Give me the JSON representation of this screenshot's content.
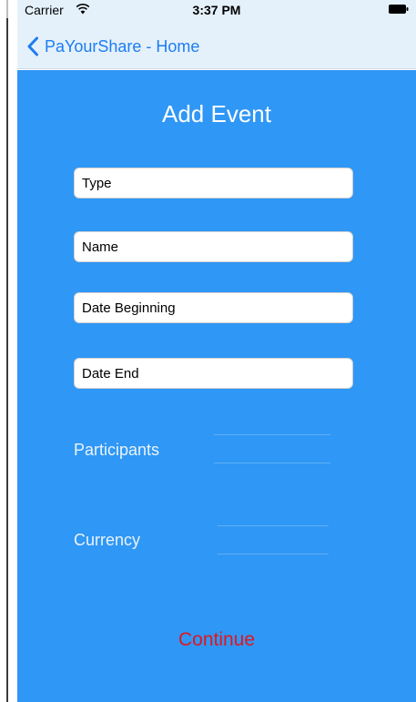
{
  "status_bar": {
    "carrier": "Carrier",
    "time": "3:37 PM",
    "wifi_icon": "wifi-icon",
    "battery_icon": "battery-icon"
  },
  "nav_bar": {
    "back_label": "PaYourShare - Home",
    "back_icon": "chevron-left-icon"
  },
  "form": {
    "title": "Add Event",
    "fields": {
      "type_placeholder": "Type",
      "name_placeholder": "Name",
      "date_begin_placeholder": "Date Beginning",
      "date_end_placeholder": "Date End"
    },
    "participants_label": "Participants",
    "currency_label": "Currency",
    "continue_label": "Continue"
  },
  "colors": {
    "background": "#2f97f5",
    "nav_background": "#e4f1fb",
    "tint": "#1e7cf2",
    "continue": "#e0161f"
  }
}
